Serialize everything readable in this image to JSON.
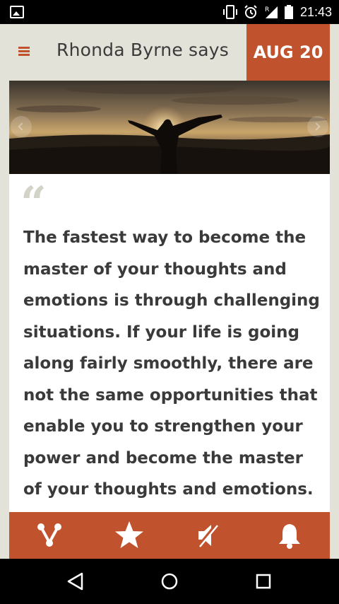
{
  "status_bar": {
    "time": "21:43",
    "icons": [
      "image-icon",
      "vibrate-icon",
      "alarm-icon",
      "signal-roaming-icon",
      "battery-icon"
    ]
  },
  "header": {
    "title": "Rhonda Byrne says",
    "date": "AUG 20",
    "menu_icon": "hamburger-menu-icon"
  },
  "banner": {
    "image": "person-arms-raised-sunset-image",
    "prev_icon": "chevron-left-icon",
    "next_icon": "chevron-right-icon"
  },
  "quote": {
    "mark": "“",
    "lines": [
      "The fastest way to become the",
      "master of your thoughts and",
      "emotions is through challenging",
      "situations. If your life is going",
      "along fairly smoothly, there are",
      "not the same opportunities that",
      "enable you to strengthen your",
      "power and become the master",
      "of your thoughts and emotions."
    ]
  },
  "actions": [
    {
      "name": "share",
      "icon": "share-icon"
    },
    {
      "name": "favorite",
      "icon": "star-icon"
    },
    {
      "name": "mute",
      "icon": "speaker-muted-icon"
    },
    {
      "name": "notifications",
      "icon": "bell-icon"
    }
  ],
  "navigation": [
    "back-icon",
    "home-icon",
    "recents-icon"
  ],
  "colors": {
    "accent": "#c0522d",
    "background": "#e2e2d8",
    "card": "#ffffff",
    "text": "#3a3a3a"
  }
}
